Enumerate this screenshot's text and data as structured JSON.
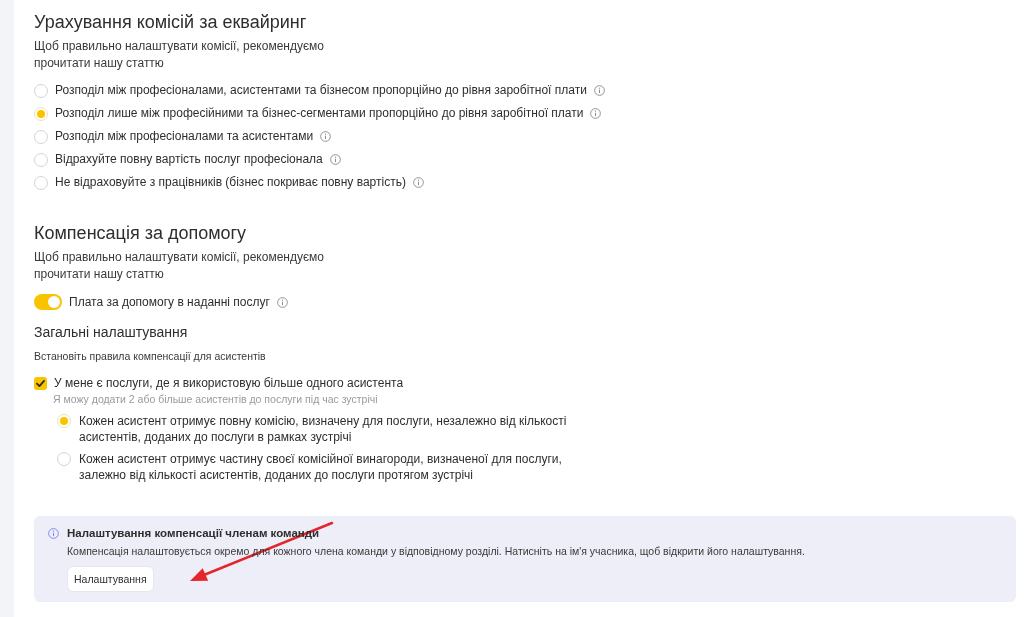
{
  "acquiring_fees": {
    "title": "Урахування комісій за еквайринг",
    "description": "Щоб правильно налаштувати комісії, рекомендуємо прочитати нашу статтю",
    "options": [
      {
        "label": "Розподіл між професіоналами, асистентами та бізнесом пропорційно до рівня заробітної плати",
        "selected": false
      },
      {
        "label": "Розподіл лише між професійними та бізнес-сегментами пропорційно до рівня заробітної плати",
        "selected": true
      },
      {
        "label": "Розподіл між професіоналами та асистентами",
        "selected": false
      },
      {
        "label": "Відрахуйте повну вартість послуг професіонала",
        "selected": false
      },
      {
        "label": "Не відраховуйте з працівників (бізнес покриває повну вартість)",
        "selected": false
      }
    ]
  },
  "assistance_compensation": {
    "title": "Компенсація за допомогу",
    "description": "Щоб правильно налаштувати комісії, рекомендуємо прочитати нашу статтю",
    "toggle": {
      "label": "Плата за допомогу в наданні послуг",
      "on": true
    },
    "general_settings": {
      "title": "Загальні налаштування",
      "description": "Встановіть правила компенсації для асистентів",
      "checkbox": {
        "label": "У мене є послуги, де я використовую більше одного асистента",
        "checked": true,
        "hint": "Я можу додати 2 або більше асистентів до послуги під час зустрічі"
      },
      "options": [
        {
          "label": "Кожен асистент отримує повну комісію, визначену для послуги, незалежно від кількості асистентів, доданих до послуги в рамках зустрічі",
          "selected": true
        },
        {
          "label": "Кожен асистент отримує частину своєї комісійної винагороди, визначеної для послуги, залежно від кількості асистентів, доданих до послуги протягом зустрічі",
          "selected": false
        }
      ]
    }
  },
  "team_compensation_notice": {
    "title": "Налаштування компенсації членам команди",
    "text": "Компенсація налаштовується окремо для кожного члена команди у відповідному розділі. Натисніть на ім'я учасника, щоб відкрити його налаштування.",
    "button": "Налаштування"
  },
  "annotation": {
    "kind": "arrow"
  }
}
